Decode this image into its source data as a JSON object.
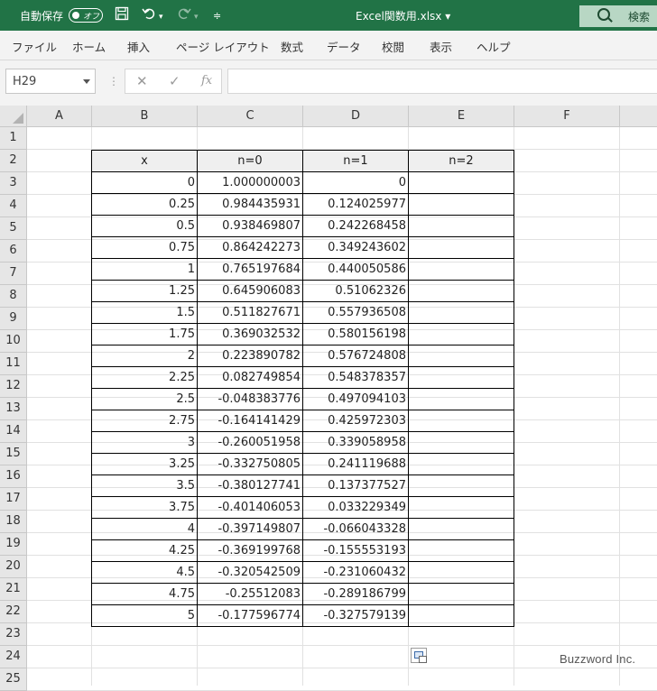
{
  "titlebar": {
    "autosave_label": "自動保存",
    "autosave_state": "オフ",
    "save_icon": "save-icon",
    "undo_icon": "undo-icon",
    "redo_icon": "redo-icon",
    "customize_icon": "customize-qat-icon",
    "filename": "Excel関数用.xlsx ▾",
    "search_label": "検索",
    "accent_color": "#217346"
  },
  "ribbon": {
    "tabs": [
      "ファイル",
      "ホーム",
      "挿入",
      "ページ レイアウト",
      "数式",
      "データ",
      "校閲",
      "表示",
      "ヘルプ"
    ]
  },
  "formula_bar": {
    "name_box": "H29",
    "formula": ""
  },
  "sheet": {
    "columns": [
      "A",
      "B",
      "C",
      "D",
      "E",
      "F"
    ],
    "rows": [
      "1",
      "2",
      "3",
      "4",
      "5",
      "6",
      "7",
      "8",
      "9",
      "10",
      "11",
      "12",
      "13",
      "14",
      "15",
      "16",
      "17",
      "18",
      "19",
      "20",
      "21",
      "22",
      "23",
      "24",
      "25"
    ],
    "table_header": [
      "x",
      "n=0",
      "n=1",
      "n=2"
    ],
    "table_rows": [
      [
        "0",
        "1.000000003",
        "0",
        ""
      ],
      [
        "0.25",
        "0.984435931",
        "0.124025977",
        ""
      ],
      [
        "0.5",
        "0.938469807",
        "0.242268458",
        ""
      ],
      [
        "0.75",
        "0.864242273",
        "0.349243602",
        ""
      ],
      [
        "1",
        "0.765197684",
        "0.440050586",
        ""
      ],
      [
        "1.25",
        "0.645906083",
        "0.51062326",
        ""
      ],
      [
        "1.5",
        "0.511827671",
        "0.557936508",
        ""
      ],
      [
        "1.75",
        "0.369032532",
        "0.580156198",
        ""
      ],
      [
        "2",
        "0.223890782",
        "0.576724808",
        ""
      ],
      [
        "2.25",
        "0.082749854",
        "0.548378357",
        ""
      ],
      [
        "2.5",
        "-0.048383776",
        "0.497094103",
        ""
      ],
      [
        "2.75",
        "-0.164141429",
        "0.425972303",
        ""
      ],
      [
        "3",
        "-0.260051958",
        "0.339058958",
        ""
      ],
      [
        "3.25",
        "-0.332750805",
        "0.241119688",
        ""
      ],
      [
        "3.5",
        "-0.380127741",
        "0.137377527",
        ""
      ],
      [
        "3.75",
        "-0.401406053",
        "0.033229349",
        ""
      ],
      [
        "4",
        "-0.397149807",
        "-0.066043328",
        ""
      ],
      [
        "4.25",
        "-0.369199768",
        "-0.155553193",
        ""
      ],
      [
        "4.5",
        "-0.320542509",
        "-0.231060432",
        ""
      ],
      [
        "4.75",
        "-0.25512083",
        "-0.289186799",
        ""
      ],
      [
        "5",
        "-0.177596774",
        "-0.327579139",
        ""
      ]
    ],
    "paste_options_icon": "paste-options-icon"
  },
  "watermark": "Buzzword Inc."
}
